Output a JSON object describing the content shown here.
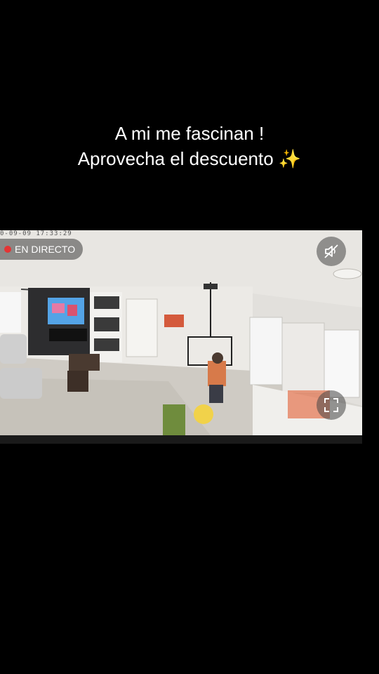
{
  "caption": {
    "line1": "A mi me fascinan !",
    "line2": "Aprovecha el descuento",
    "emoji": "✨"
  },
  "player": {
    "timestamp": "0-09-09   17:33:29",
    "live_label": "EN DIRECTO",
    "live_color": "#e43434",
    "mute_icon": "speaker-muted-icon",
    "fullscreen_icon": "fullscreen-icon"
  }
}
